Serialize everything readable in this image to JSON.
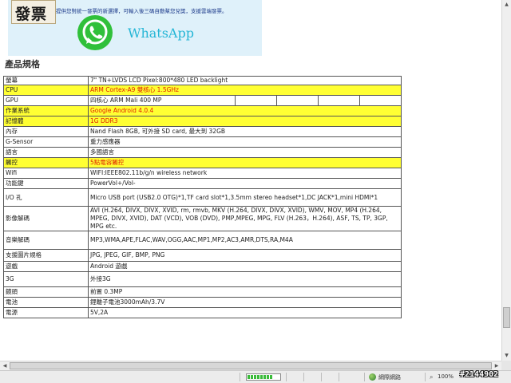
{
  "banner": {
    "logo_text": "發票",
    "promo_text": "提供您對統一發票的新選擇，可輸入後三碼自動幫您兌獎，支援雲端發票。",
    "whatsapp_label": "WhatsApp"
  },
  "section_title": "產品規格",
  "spec_rows": [
    {
      "label": "螢幕",
      "value": "7\" TN+LVDS LCD  Pixel:800*480 LED backlight",
      "highlight": false
    },
    {
      "label": "CPU",
      "value": "ARM Cortex-A9 雙核心 1.5GHz",
      "highlight": true
    },
    {
      "label": "GPU",
      "value": "四核心 ARM Mali 400 MP",
      "highlight": false
    },
    {
      "label": "作業系統",
      "value": "Google Android  4.0.4",
      "highlight": true
    },
    {
      "label": "記憶體",
      "value": "1G DDR3",
      "highlight": true
    },
    {
      "label": "內存",
      "value": "Nand Flash 8GB, 可外接 SD card, 最大到 32GB",
      "highlight": false
    },
    {
      "label": "G-Sensor",
      "value": "重力感應器",
      "highlight": false
    },
    {
      "label": "語言",
      "value": "多國語言",
      "highlight": false
    },
    {
      "label": "觸控",
      "value": "5點電容觸控",
      "highlight": true
    },
    {
      "label": "Wifi",
      "value": "WIFI:IEEE802.11b/g/n wireless network",
      "highlight": false
    },
    {
      "label": "功能鍵",
      "value": "PowerVol+/Vol-",
      "highlight": false
    },
    {
      "label": "I/O 孔",
      "value": "Micro USB port (USB2.0 OTG)*1,TF card slot*1,3.5mm stereo headset*1,DC JACK*1,mini HDMI*1",
      "highlight": false
    },
    {
      "label": "影像解碼",
      "value": "AVI (H.264, DIVX, DIVX, XVID, rm, rmvb,  MKV (H.264, DIVX, DIVX, XVID), WMV, MOV, MP4 (H.264, MPEG, DIVX, XVID), DAT (VCD), VOB (DVD), PMP,MPEG, MPG, FLV (H.263，H.264), ASF, TS, TP, 3GP, MPG etc.",
      "highlight": false
    },
    {
      "label": "音樂解碼",
      "value": "MP3,WMA,APE,FLAC,WAV,OGG,AAC,MP1,MP2,AC3,AMR,DTS,RA,M4A",
      "highlight": false
    },
    {
      "label": "支援圖片規格",
      "value": "JPG, JPEG, GIF, BMP, PNG",
      "highlight": false
    },
    {
      "label": "遊戲",
      "value": "Android 遊戲",
      "highlight": false
    },
    {
      "label": "3G",
      "value": "外接3G",
      "highlight": false
    },
    {
      "label": "鏡頭",
      "value": "前置 0.3MP",
      "highlight": false
    },
    {
      "label": "電池",
      "value": "鋰離子電池3000mAh/3.7V",
      "highlight": false
    },
    {
      "label": "電源",
      "value": "5V,2A",
      "highlight": false
    }
  ],
  "status": {
    "zone_label": "網際網路",
    "zoom_icon": "zoom-icon",
    "zoom_value": "100%",
    "progress_fraction": 0.8
  },
  "post_id": "#2144902"
}
